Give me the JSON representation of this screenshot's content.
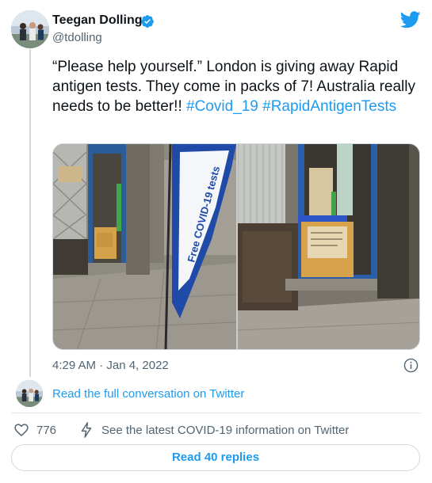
{
  "author": {
    "name": "Teegan Dolling",
    "handle": "@tdolling",
    "verified": true
  },
  "tweet": {
    "text": "“Please help yourself.” London is giving away Rapid antigen tests. They come in packs of 7! Australia really needs to be better!!",
    "hashtags": [
      "#Covid_19",
      "#RapidAntigenTests"
    ],
    "timestamp": "4:29 AM · Jan 4, 2022"
  },
  "media": {
    "photos": [
      {
        "name": "street-doorway-with-free-covid-flag"
      },
      {
        "name": "doorway-with-test-box"
      }
    ],
    "flag_text": "Free COVID-19 tests"
  },
  "conversation": {
    "link_label": "Read the full conversation on Twitter"
  },
  "actions": {
    "like_count": "776",
    "covid_info_label": "See the latest COVID-19 information on Twitter",
    "replies_label": "Read 40 replies"
  },
  "colors": {
    "accent": "#1d9bf0",
    "text": "#0f1419",
    "secondary": "#536471",
    "border": "#cfd9de",
    "verified": "#1d9bf0"
  }
}
